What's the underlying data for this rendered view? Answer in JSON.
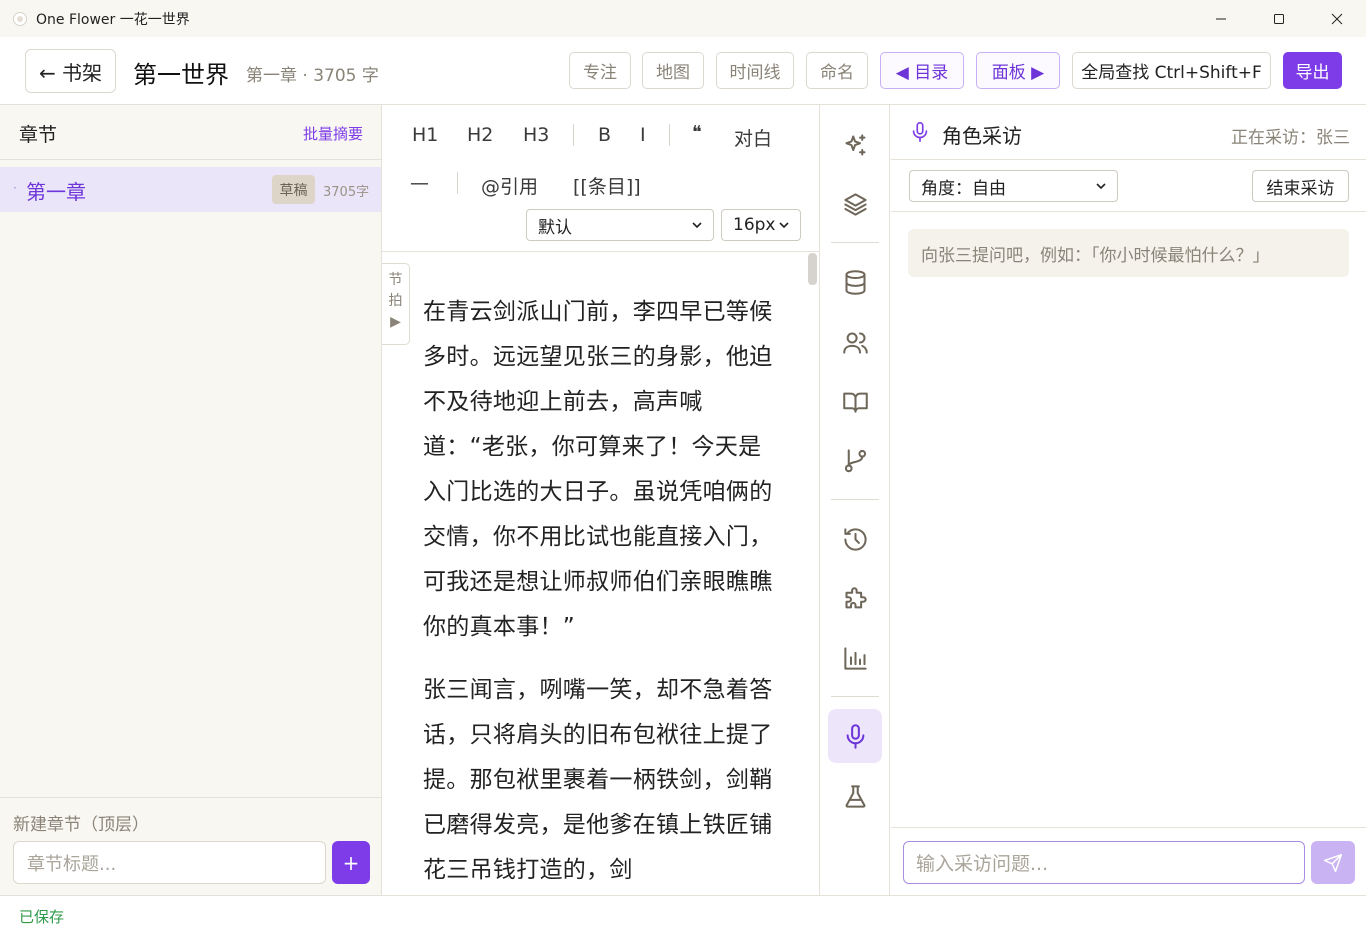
{
  "window": {
    "title": "One Flower 一花一世界",
    "minimize_icon": "minimize-icon",
    "maximize_icon": "maximize-icon",
    "close_icon": "close-icon"
  },
  "header": {
    "back_label": "← 书架",
    "world_title": "第一世界",
    "chapter_meta": "第一章 · 3705 字",
    "buttons": {
      "focus": "专注",
      "map": "地图",
      "timeline": "时间线",
      "naming": "命名",
      "toc": "◀ 目录",
      "panel": "面板 ▶",
      "search": "全局查找 Ctrl+Shift+F",
      "export": "导出"
    }
  },
  "sidebar": {
    "title": "章节",
    "batch_summary": "批量摘要",
    "chapters": [
      {
        "dot": "·",
        "name": "第一章",
        "status": "草稿",
        "count": "3705字"
      }
    ],
    "new_chapter_label": "新建章节（顶层）",
    "new_chapter_placeholder": "章节标题...",
    "add_label": "+"
  },
  "editor": {
    "toolbar": {
      "h1": "H1",
      "h2": "H2",
      "h3": "H3",
      "bold": "B",
      "italic": "I",
      "quote": "❝",
      "dialogue": "对白",
      "hr": "—",
      "cite": "@引用",
      "entry": "[[条目]]",
      "font_select": "默认",
      "size_select": "16px"
    },
    "beat_tab": [
      "节",
      "拍",
      "▶"
    ],
    "paragraphs": [
      "在青云剑派山门前，李四早已等候多时。远远望见张三的身影，他迫不及待地迎上前去，高声喊道：“老张，你可算来了！今天是入门比选的大日子。虽说凭咱俩的交情，你不用比试也能直接入门，可我还是想让师叔师伯们亲眼瞧瞧你的真本事！”",
      "张三闻言，咧嘴一笑，却不急着答话，只将肩头的旧布包袱往上提了提。那包袱里裹着一柄铁剑，剑鞘已磨得发亮，是他爹在镇上铁匠铺花三吊钱打造的，剑"
    ]
  },
  "rail": {
    "icons": [
      "sparkles-icon",
      "layers-icon",
      "database-icon",
      "users-icon",
      "book-open-icon",
      "git-branch-icon",
      "history-icon",
      "puzzle-icon",
      "bar-chart-icon",
      "mic-icon",
      "flask-icon"
    ]
  },
  "panel": {
    "title": "角色采访",
    "status": "正在采访：张三",
    "angle_select": "角度：自由",
    "end_button": "结束采访",
    "hint": "向张三提问吧，例如：「你小时候最怕什么？」",
    "input_placeholder": "输入采访问题...",
    "send_icon": "send-icon"
  },
  "statusbar": {
    "saved": "已保存"
  },
  "colors": {
    "accent": "#7d3ce8",
    "saved_green": "#2f9a4a",
    "sidebar_bg": "#f9f7f2"
  }
}
